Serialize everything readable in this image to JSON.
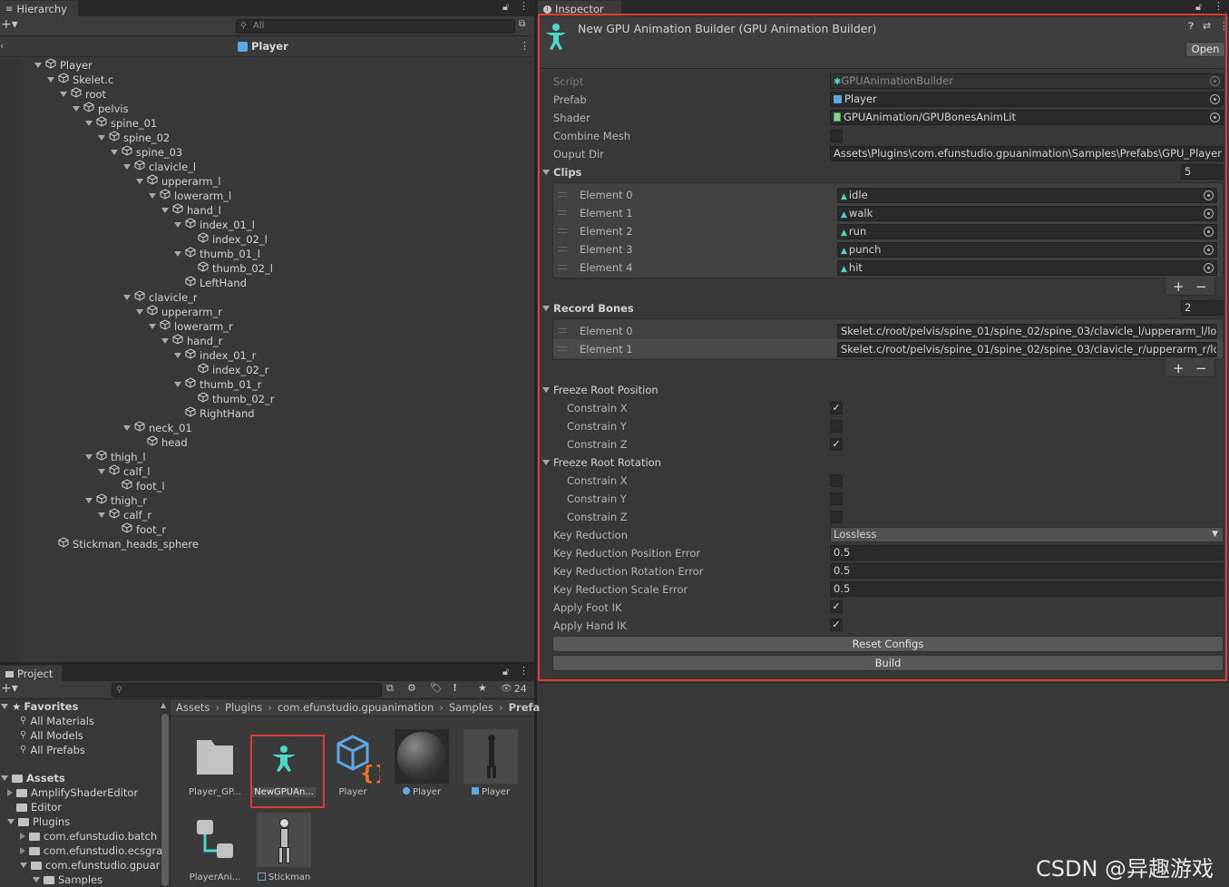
{
  "colors": {
    "highlight": "#e03a3a",
    "bg": "#383838",
    "field": "#2a2a2a",
    "accent": "#4fd6c8"
  },
  "hierarchy": {
    "tab_label": "Hierarchy",
    "search_placeholder": "All",
    "scene_title": "Player",
    "items": [
      {
        "label": "Player",
        "depth": 0,
        "fold": true
      },
      {
        "label": "Skelet.c",
        "depth": 1,
        "fold": true
      },
      {
        "label": "root",
        "depth": 2,
        "fold": true
      },
      {
        "label": "pelvis",
        "depth": 3,
        "fold": true
      },
      {
        "label": "spine_01",
        "depth": 4,
        "fold": true
      },
      {
        "label": "spine_02",
        "depth": 5,
        "fold": true
      },
      {
        "label": "spine_03",
        "depth": 6,
        "fold": true
      },
      {
        "label": "clavicle_l",
        "depth": 7,
        "fold": true
      },
      {
        "label": "upperarm_l",
        "depth": 8,
        "fold": true
      },
      {
        "label": "lowerarm_l",
        "depth": 9,
        "fold": true
      },
      {
        "label": "hand_l",
        "depth": 10,
        "fold": true
      },
      {
        "label": "index_01_l",
        "depth": 11,
        "fold": true
      },
      {
        "label": "index_02_l",
        "depth": 12,
        "fold": false
      },
      {
        "label": "thumb_01_l",
        "depth": 11,
        "fold": true
      },
      {
        "label": "thumb_02_l",
        "depth": 12,
        "fold": false
      },
      {
        "label": "LeftHand",
        "depth": 11,
        "fold": false
      },
      {
        "label": "clavicle_r",
        "depth": 7,
        "fold": true
      },
      {
        "label": "upperarm_r",
        "depth": 8,
        "fold": true
      },
      {
        "label": "lowerarm_r",
        "depth": 9,
        "fold": true
      },
      {
        "label": "hand_r",
        "depth": 10,
        "fold": true
      },
      {
        "label": "index_01_r",
        "depth": 11,
        "fold": true
      },
      {
        "label": "index_02_r",
        "depth": 12,
        "fold": false
      },
      {
        "label": "thumb_01_r",
        "depth": 11,
        "fold": true
      },
      {
        "label": "thumb_02_r",
        "depth": 12,
        "fold": false
      },
      {
        "label": "RightHand",
        "depth": 11,
        "fold": false
      },
      {
        "label": "neck_01",
        "depth": 7,
        "fold": true
      },
      {
        "label": "head",
        "depth": 8,
        "fold": false
      },
      {
        "label": "thigh_l",
        "depth": 4,
        "fold": true
      },
      {
        "label": "calf_l",
        "depth": 5,
        "fold": true
      },
      {
        "label": "foot_l",
        "depth": 6,
        "fold": false
      },
      {
        "label": "thigh_r",
        "depth": 4,
        "fold": true
      },
      {
        "label": "calf_r",
        "depth": 5,
        "fold": true
      },
      {
        "label": "foot_r",
        "depth": 6,
        "fold": false
      },
      {
        "label": "Stickman_heads_sphere",
        "depth": 1,
        "fold": false
      }
    ]
  },
  "inspector": {
    "tab_label": "Inspector",
    "title": "New GPU Animation Builder (GPU Animation Builder)",
    "open_label": "Open",
    "script_label": "Script",
    "script_value": "GPUAnimationBuilder",
    "prefab_label": "Prefab",
    "prefab_value": "Player",
    "shader_label": "Shader",
    "shader_value": "GPUAnimation/GPUBonesAnimLit",
    "combine_mesh_label": "Combine Mesh",
    "output_dir_label": "Ouput Dir",
    "output_dir_value": "Assets\\Plugins\\com.efunstudio.gpuanimation\\Samples\\Prefabs\\GPU_Player",
    "clips_label": "Clips",
    "clips_count": "5",
    "clips": [
      {
        "label": "Element 0",
        "value": "idle"
      },
      {
        "label": "Element 1",
        "value": "walk"
      },
      {
        "label": "Element 2",
        "value": "run"
      },
      {
        "label": "Element 3",
        "value": "punch"
      },
      {
        "label": "Element 4",
        "value": "hit"
      }
    ],
    "record_bones_label": "Record Bones",
    "record_bones_count": "2",
    "record_bones": [
      {
        "label": "Element 0",
        "value": "Skelet.c/root/pelvis/spine_01/spine_02/spine_03/clavicle_l/upperarm_l/low"
      },
      {
        "label": "Element 1",
        "value": "Skelet.c/root/pelvis/spine_01/spine_02/spine_03/clavicle_r/upperarm_r/low"
      }
    ],
    "plus": "+",
    "minus": "−",
    "freeze_pos_label": "Freeze Root Position",
    "freeze_pos": [
      {
        "label": "Constrain X",
        "checked": true
      },
      {
        "label": "Constrain Y",
        "checked": false
      },
      {
        "label": "Constrain Z",
        "checked": true
      }
    ],
    "freeze_rot_label": "Freeze Root Rotation",
    "freeze_rot": [
      {
        "label": "Constrain X",
        "checked": false
      },
      {
        "label": "Constrain Y",
        "checked": false
      },
      {
        "label": "Constrain Z",
        "checked": false
      }
    ],
    "key_reduction_label": "Key Reduction",
    "key_reduction_value": "Lossless",
    "kr_pos_label": "Key Reduction Position Error",
    "kr_pos_value": "0.5",
    "kr_rot_label": "Key Reduction Rotation Error",
    "kr_rot_value": "0.5",
    "kr_scale_label": "Key Reduction Scale Error",
    "kr_scale_value": "0.5",
    "apply_foot_ik_label": "Apply Foot IK",
    "apply_hand_ik_label": "Apply Hand IK",
    "reset_label": "Reset Configs",
    "build_label": "Build"
  },
  "project": {
    "tab_label": "Project",
    "hidden_count": "24",
    "breadcrumb": [
      "Assets",
      "Plugins",
      "com.efunstudio.gpuanimation",
      "Samples",
      "Prefa"
    ],
    "favorites_label": "Favorites",
    "favorites": [
      "All Materials",
      "All Models",
      "All Prefabs"
    ],
    "assets_label": "Assets",
    "tree": [
      {
        "label": "AmplifyShaderEditor",
        "depth": 1,
        "arrow": true
      },
      {
        "label": "Editor",
        "depth": 1,
        "arrow": false
      },
      {
        "label": "Plugins",
        "depth": 1,
        "arrow": true
      },
      {
        "label": "com.efunstudio.batch",
        "depth": 2,
        "arrow": true
      },
      {
        "label": "com.efunstudio.ecsgra",
        "depth": 2,
        "arrow": true
      },
      {
        "label": "com.efunstudio.gpuar",
        "depth": 2,
        "arrow": true
      },
      {
        "label": "Samples",
        "depth": 3,
        "arrow": true
      }
    ],
    "assets": [
      {
        "label": "Player_GP..."
      },
      {
        "label": "NewGPUAn..."
      },
      {
        "label": "Player"
      },
      {
        "label": "Player"
      },
      {
        "label": "Player"
      },
      {
        "label": "PlayerAni..."
      },
      {
        "label": "Stickman"
      }
    ]
  },
  "watermark": "CSDN @异趣游戏"
}
